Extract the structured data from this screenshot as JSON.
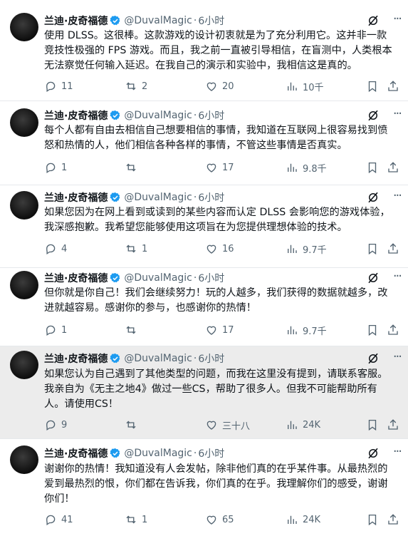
{
  "author": {
    "name": "兰迪·皮奇福德",
    "handle": "@DuvalMagic",
    "time": "6小时"
  },
  "colors": {
    "verified": "#1d9bf0",
    "text": "#0f1419",
    "muted": "#536471",
    "highlight_bg": "#ececec"
  },
  "icons": {
    "verified": "verified-badge-icon",
    "grok": "grok-icon",
    "more": "more-icon",
    "reply": "reply-icon",
    "retweet": "retweet-icon",
    "like": "like-icon",
    "views": "views-icon",
    "bookmark": "bookmark-icon",
    "share": "share-icon"
  },
  "more_glyph": "···",
  "tweets": [
    {
      "lines": [
        "使用 DLSS。这很棒。这款游戏的设计初衷就是为了充分利用它。这并非一款",
        "竞技性极强的 FPS 游戏。而且，我之前一直被引导相信，在盲测中，人类根本",
        "无法察觉任何输入延迟。在我自己的演示和实验中，我相信这是真的。"
      ],
      "replies": "11",
      "retweets": "2",
      "likes": "20",
      "views": "10千"
    },
    {
      "lines": [
        "每个人都有自由去相信自己想要相信的事情，我知道在互联网上很容易找到愤",
        "怒和热情的人，他们相信各种各样的事情，不管这些事情是否真实。"
      ],
      "replies": "1",
      "retweets": "",
      "likes": "17",
      "views": "9.8千"
    },
    {
      "lines": [
        "如果您因为在网上看到或读到的某些内容而认定 DLSS 会影响您的游戏体验，",
        "我深感抱歉。我希望您能够使用这项旨在为您提供理想体验的技术。"
      ],
      "replies": "4",
      "retweets": "1",
      "likes": "16",
      "views": "9.7千"
    },
    {
      "lines": [
        "但你就是你自己！我们会继续努力！玩的人越多，我们获得的数据就越多，改",
        "进就越容易。感谢你的参与，也感谢你的热情！"
      ],
      "replies": "1",
      "retweets": "",
      "likes": "17",
      "views": "9.7千"
    },
    {
      "lines": [
        "如果您认为自己遇到了其他类型的问题，而我在这里没有提到，请联系客服。",
        "我亲自为《无主之地4》做过一些CS，帮助了很多人。但我不可能帮助所有",
        "人。请使用CS！"
      ],
      "replies": "9",
      "retweets": "",
      "likes": "三十八",
      "views": "24K"
    },
    {
      "lines": [
        "谢谢你的热情！我知道没有人会发帖，除非他们真的在乎某件事。从最热烈的",
        "爱到最热烈的恨，你们都在告诉我，你们真的在乎。我理解你们的感受，谢谢",
        "你们！"
      ],
      "replies": "41",
      "retweets": "1",
      "likes": "65",
      "views": "24K"
    }
  ]
}
